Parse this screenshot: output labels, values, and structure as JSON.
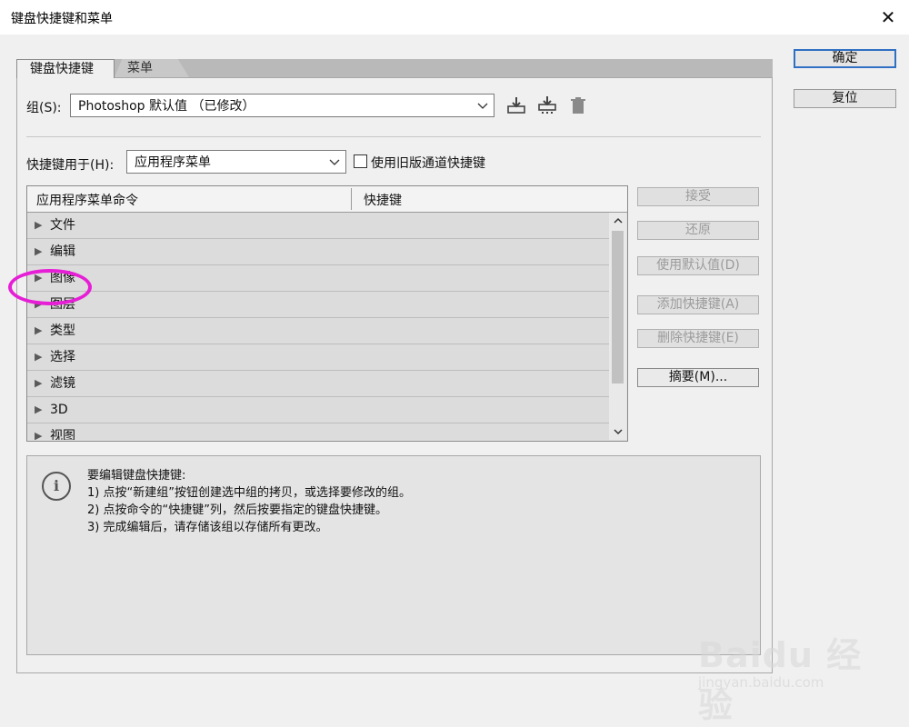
{
  "window": {
    "title": "键盘快捷键和菜单",
    "close_glyph": "✕"
  },
  "tabs": [
    {
      "label": "键盘快捷键",
      "active": true
    },
    {
      "label": "菜单",
      "active": false
    }
  ],
  "set": {
    "label": "组(S):",
    "value": "Photoshop 默认值 （已修改）",
    "icons": [
      "save-set-icon",
      "save-new-set-icon",
      "delete-set-icon"
    ]
  },
  "shortcuts_for": {
    "label": "快捷键用于(H):",
    "value": "应用程序菜单",
    "legacy_checkbox_label": "使用旧版通道快捷键",
    "legacy_checked": false
  },
  "table": {
    "columns": [
      "应用程序菜单命令",
      "快捷键"
    ],
    "rows": [
      "文件",
      "编辑",
      "图像",
      "图层",
      "类型",
      "选择",
      "滤镜",
      "3D",
      "视图"
    ]
  },
  "side_buttons": [
    {
      "label": "接受",
      "enabled": false
    },
    {
      "label": "还原",
      "enabled": false
    },
    {
      "label": "使用默认值(D)",
      "enabled": false
    },
    {
      "label": "添加快捷键(A)",
      "enabled": false
    },
    {
      "label": "删除快捷键(E)",
      "enabled": false
    },
    {
      "label": "摘要(M)...",
      "enabled": true
    }
  ],
  "info": {
    "heading": "要编辑键盘快捷键:",
    "steps": [
      "1) 点按“新建组”按钮创建选中组的拷贝，或选择要修改的组。",
      "2) 点按命令的“快捷键”列，然后按要指定的键盘快捷键。",
      "3) 完成编辑后，请存储该组以存储所有更改。"
    ]
  },
  "dialog_buttons": {
    "ok": "确定",
    "reset": "复位"
  },
  "watermark": {
    "brand": "Baidu 经验",
    "url": "jingyan.baidu.com"
  },
  "colors": {
    "annotation": "#e61ed6",
    "default_button_border": "#2f6fc4"
  }
}
